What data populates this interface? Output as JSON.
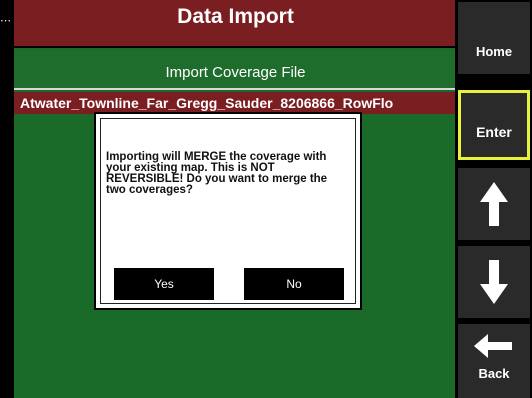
{
  "header": {
    "title": "Data Import",
    "subtitle": "Import Coverage File"
  },
  "file": {
    "name": "Atwater_Townline_Far_Gregg_Sauder_8206866_RowFlo"
  },
  "dialog": {
    "message": "Importing will MERGE the coverage with your existing map. This is NOT REVERSIBLE! Do you want to merge the two coverages?",
    "yes_label": "Yes",
    "no_label": "No"
  },
  "sidebar": {
    "home_label": "Home",
    "enter_label": "Enter",
    "up_icon": "arrow-up-icon",
    "down_icon": "arrow-down-icon",
    "back_icon": "arrow-left-icon",
    "back_label": "Back"
  },
  "colors": {
    "title_bar": "#7a1e22",
    "panel_green": "#1a6a2a",
    "enter_highlight": "#e8f23a"
  }
}
